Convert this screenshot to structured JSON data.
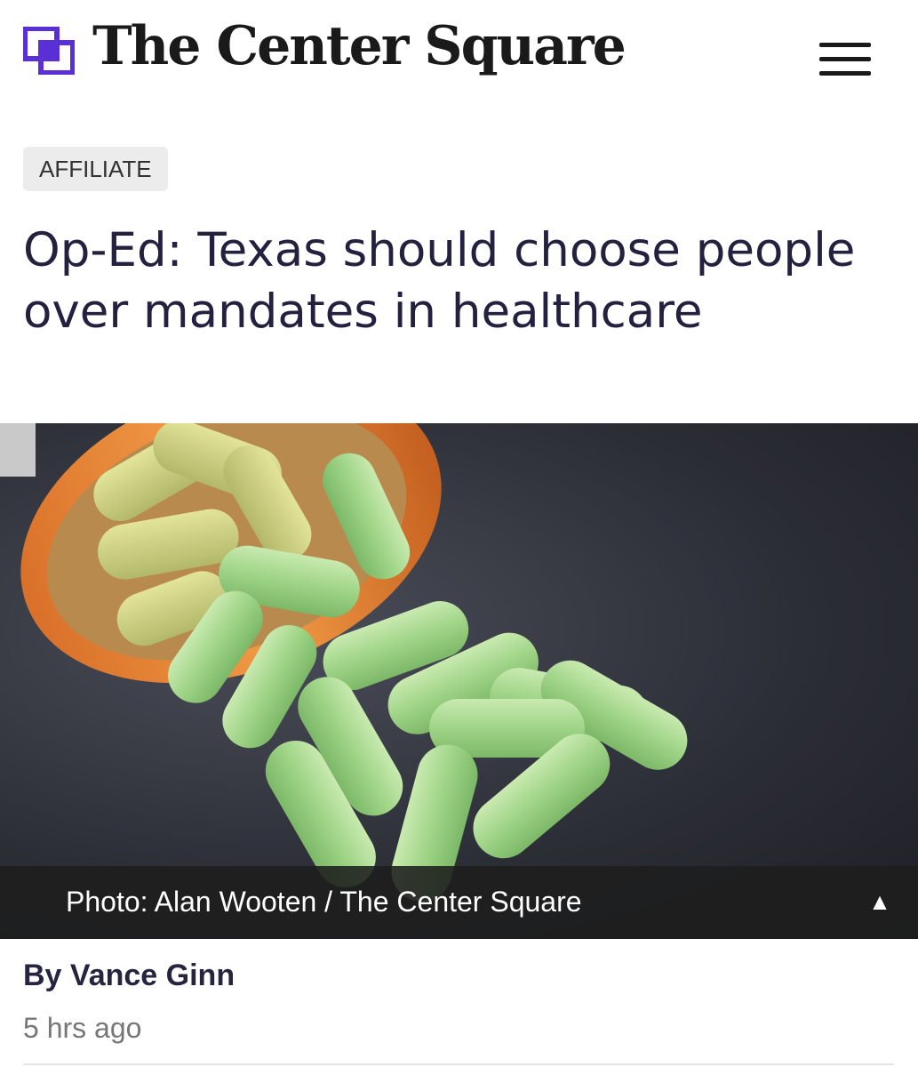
{
  "site": {
    "name": "The Center Square",
    "brand_color": "#5b2fd6",
    "logo_icon": "overlapping-squares-logo",
    "menu_icon": "hamburger-menu-icon"
  },
  "article": {
    "category": "AFFILIATE",
    "headline": "Op-Ed: Texas should choose people over mandates in healthcare",
    "photo": {
      "caption": "Photo: Alan Wooten / The Center Square",
      "toggle_icon": "▲"
    },
    "byline": "By Vance Ginn",
    "timestamp": "5 hrs ago"
  },
  "colors": {
    "headline": "#23213f",
    "badge_bg": "#ececec",
    "caption_bg": "#1e1e1e"
  }
}
